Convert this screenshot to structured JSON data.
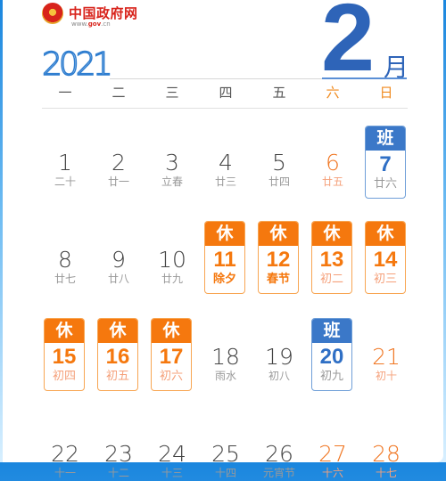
{
  "header": {
    "site_name": "中国政府网",
    "site_url_prefix": "www.",
    "site_url_bold": "gov",
    "site_url_suffix": ".cn",
    "year": "2021",
    "month_number": "2",
    "month_char": "月"
  },
  "colors": {
    "holiday_orange": "#f5780e",
    "workday_blue": "#3b78c8",
    "month_blue": "#2e64b8"
  },
  "weekdays": [
    {
      "label": "一",
      "weekend": false
    },
    {
      "label": "二",
      "weekend": false
    },
    {
      "label": "三",
      "weekend": false
    },
    {
      "label": "四",
      "weekend": false
    },
    {
      "label": "五",
      "weekend": false
    },
    {
      "label": "六",
      "weekend": true
    },
    {
      "label": "日",
      "weekend": true
    }
  ],
  "days": [
    {
      "day": "1",
      "lunar": "二十",
      "col": 0,
      "row": 0
    },
    {
      "day": "2",
      "lunar": "廿一",
      "col": 1,
      "row": 0
    },
    {
      "day": "3",
      "lunar": "立春",
      "col": 2,
      "row": 0
    },
    {
      "day": "4",
      "lunar": "廿三",
      "col": 3,
      "row": 0
    },
    {
      "day": "5",
      "lunar": "廿四",
      "col": 4,
      "row": 0
    },
    {
      "day": "6",
      "lunar": "廿五",
      "col": 5,
      "row": 0,
      "weekend": true
    },
    {
      "day": "7",
      "lunar": "廿六",
      "col": 6,
      "row": 0,
      "tag": "班",
      "type": "work"
    },
    {
      "day": "8",
      "lunar": "廿七",
      "col": 0,
      "row": 1
    },
    {
      "day": "9",
      "lunar": "廿八",
      "col": 1,
      "row": 1
    },
    {
      "day": "10",
      "lunar": "廿九",
      "col": 2,
      "row": 1
    },
    {
      "day": "11",
      "lunar": "除夕",
      "col": 3,
      "row": 1,
      "tag": "休",
      "type": "rest",
      "festival": true
    },
    {
      "day": "12",
      "lunar": "春节",
      "col": 4,
      "row": 1,
      "tag": "休",
      "type": "rest",
      "festival": true
    },
    {
      "day": "13",
      "lunar": "初二",
      "col": 5,
      "row": 1,
      "tag": "休",
      "type": "rest"
    },
    {
      "day": "14",
      "lunar": "初三",
      "col": 6,
      "row": 1,
      "tag": "休",
      "type": "rest"
    },
    {
      "day": "15",
      "lunar": "初四",
      "col": 0,
      "row": 2,
      "tag": "休",
      "type": "rest"
    },
    {
      "day": "16",
      "lunar": "初五",
      "col": 1,
      "row": 2,
      "tag": "休",
      "type": "rest"
    },
    {
      "day": "17",
      "lunar": "初六",
      "col": 2,
      "row": 2,
      "tag": "休",
      "type": "rest"
    },
    {
      "day": "18",
      "lunar": "雨水",
      "col": 3,
      "row": 2
    },
    {
      "day": "19",
      "lunar": "初八",
      "col": 4,
      "row": 2
    },
    {
      "day": "20",
      "lunar": "初九",
      "col": 5,
      "row": 2,
      "tag": "班",
      "type": "work"
    },
    {
      "day": "21",
      "lunar": "初十",
      "col": 6,
      "row": 2,
      "weekend": true
    },
    {
      "day": "22",
      "lunar": "十一",
      "col": 0,
      "row": 3
    },
    {
      "day": "23",
      "lunar": "十二",
      "col": 1,
      "row": 3
    },
    {
      "day": "24",
      "lunar": "十三",
      "col": 2,
      "row": 3
    },
    {
      "day": "25",
      "lunar": "十四",
      "col": 3,
      "row": 3
    },
    {
      "day": "26",
      "lunar": "元宵节",
      "col": 4,
      "row": 3
    },
    {
      "day": "27",
      "lunar": "十六",
      "col": 5,
      "row": 3,
      "weekend": true
    },
    {
      "day": "28",
      "lunar": "十七",
      "col": 6,
      "row": 3,
      "weekend": true
    }
  ]
}
